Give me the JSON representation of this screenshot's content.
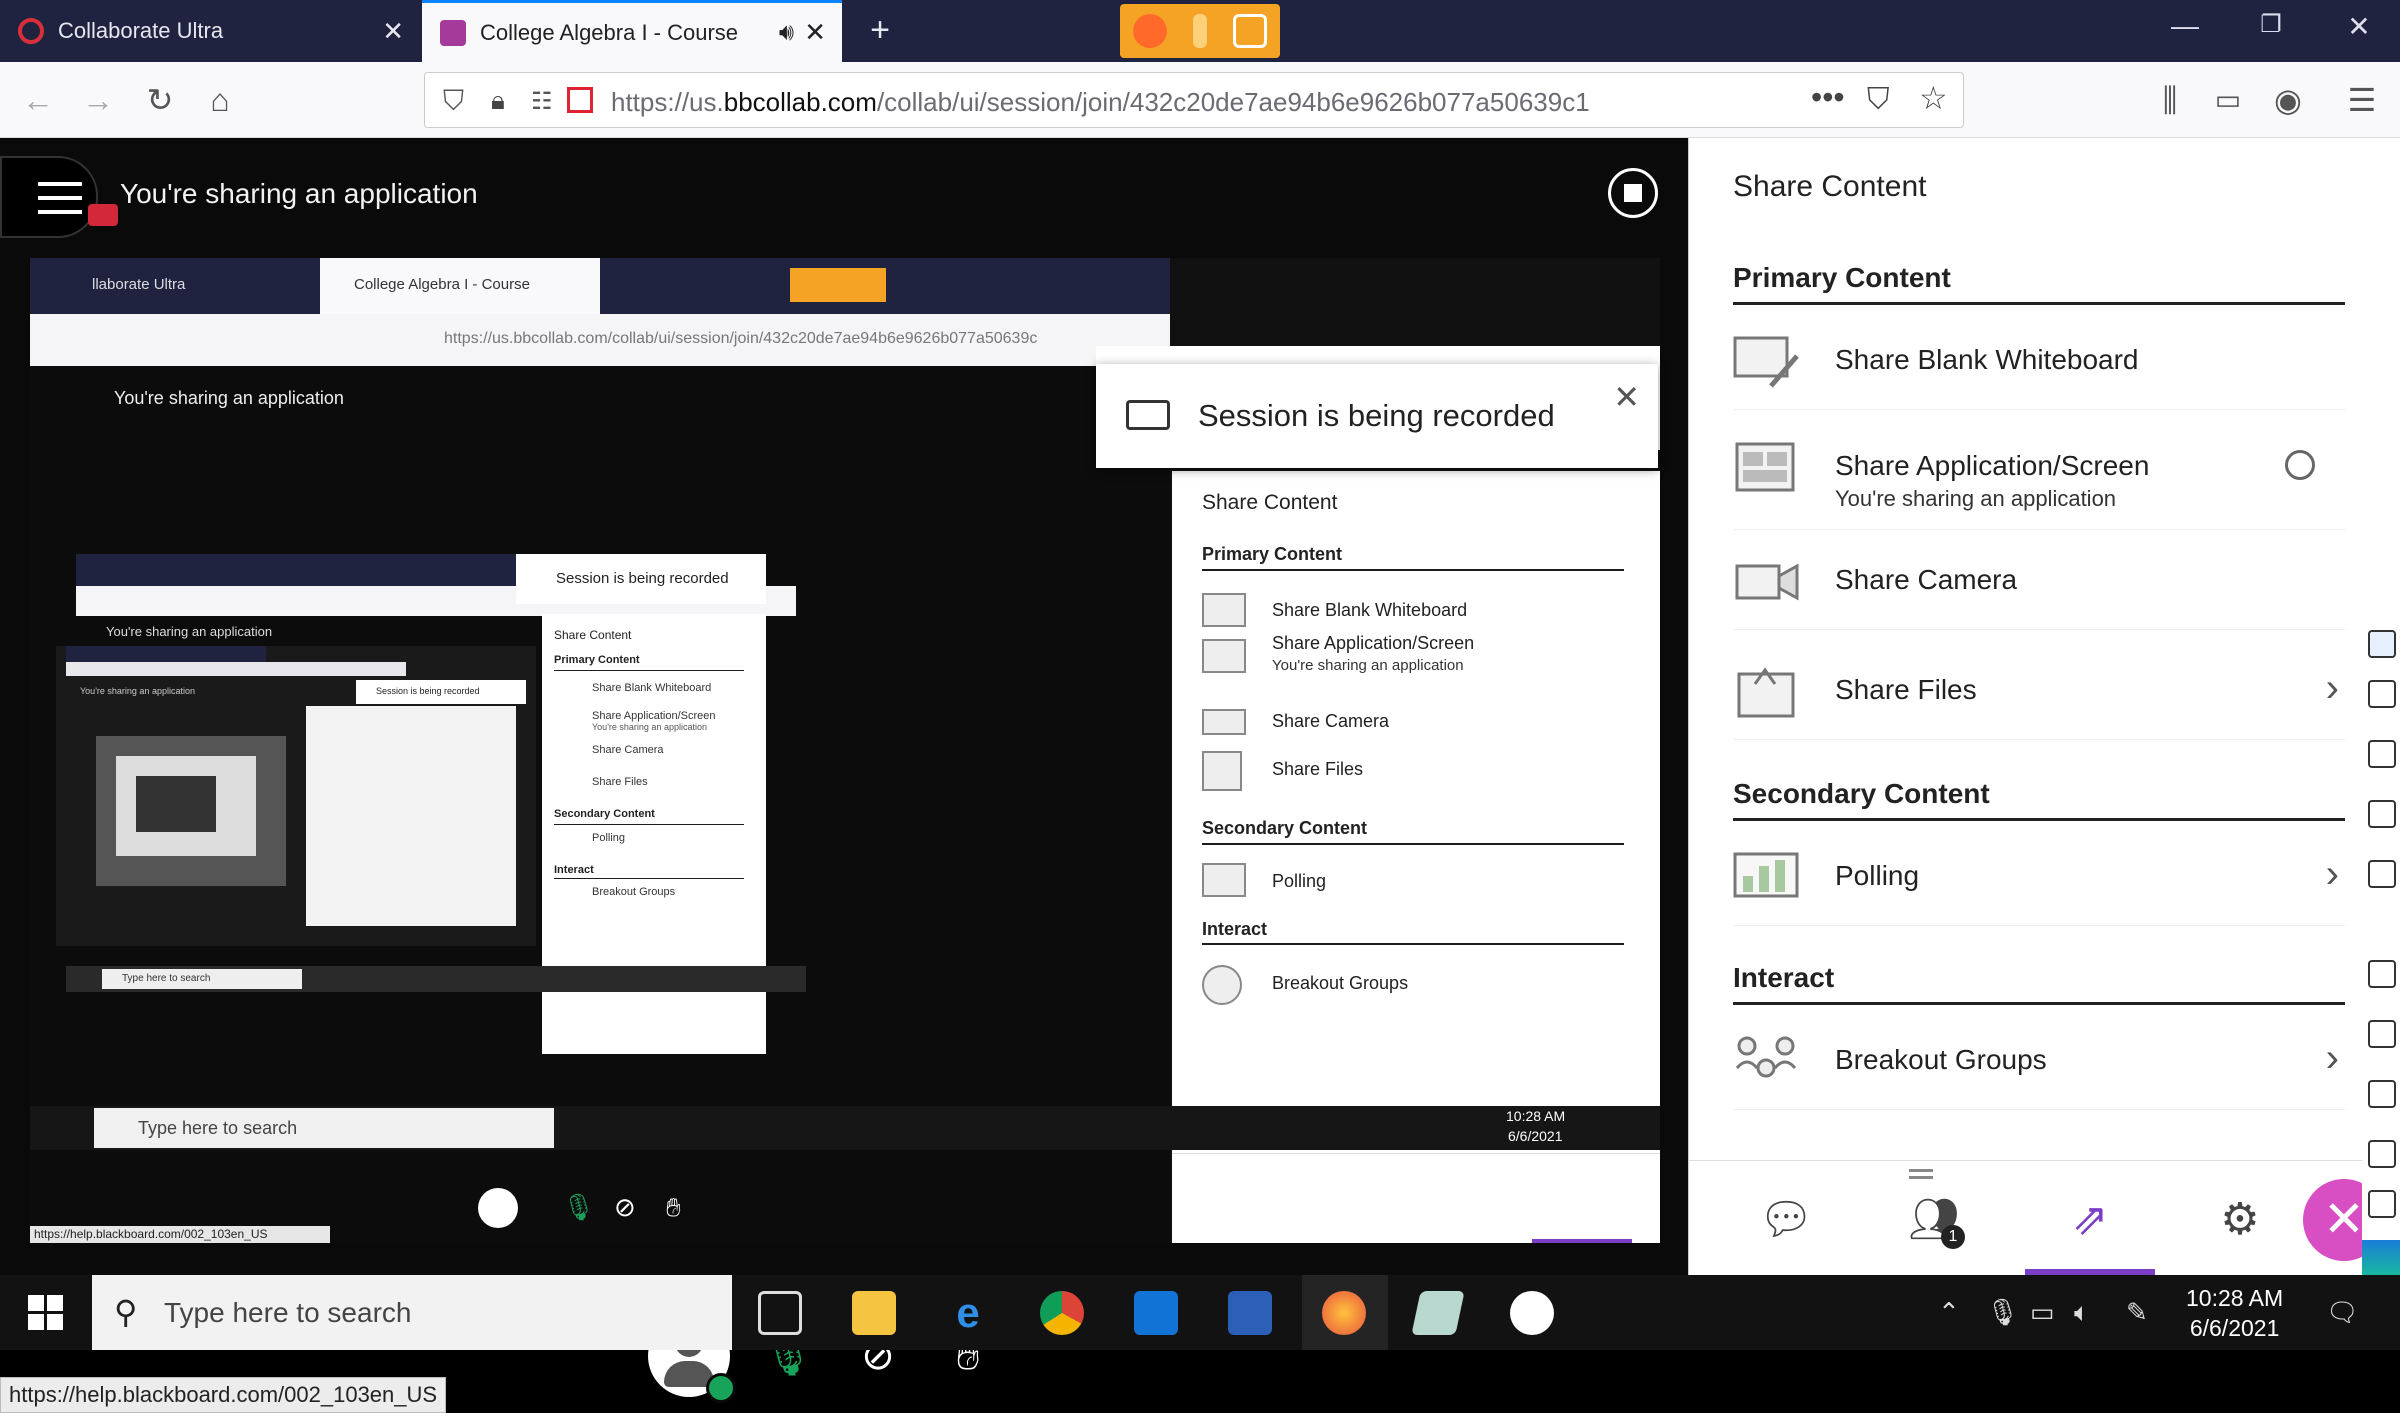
{
  "browser": {
    "tabs": [
      {
        "title": "Collaborate Ultra",
        "active": false
      },
      {
        "title": "College Algebra I - Course",
        "active": true
      }
    ],
    "url_prefix": "https://us.",
    "url_domain": "bbcollab.com",
    "url_path": "/collab/ui/session/join/432c20de7ae94b6e9626b077a50639c1"
  },
  "stage": {
    "sharing_label": "You're sharing an application",
    "recorded_toast": "Session is being recorded",
    "status_url": "https://help.blackboard.com/002_103en_US"
  },
  "nested": {
    "tab1": "llaborate Ultra",
    "tab2": "College Algebra I - Course",
    "url": "https://us.bbcollab.com/collab/ui/session/join/432c20de7ae94b6e9626b077a50639c",
    "sharing_label": "You're sharing an application",
    "recorded_toast": "Session is being recorded",
    "panel_title": "Share Content",
    "primary": "Primary Content",
    "whiteboard": "Share Blank Whiteboard",
    "app": "Share Application/Screen",
    "app_sub": "You're sharing an application",
    "camera": "Share Camera",
    "files": "Share Files",
    "secondary": "Secondary Content",
    "polling": "Polling",
    "interact": "Interact",
    "breakout": "Breakout Groups",
    "status_url": "https://help.blackboard.com/002_103en_US",
    "search": "Type here to search",
    "time": "10:28 AM",
    "date": "6/6/2021",
    "level2_sharing": "You're sharing an application",
    "level2_toast": "Session is being recorded",
    "level2_panel": "Share Content",
    "level2_primary": "Primary Content",
    "level2_whiteboard": "Share Blank Whiteboard",
    "level2_app": "Share Application/Screen",
    "level2_app_sub": "You're sharing an application",
    "level2_camera": "Share Camera",
    "level2_files": "Share Files",
    "level2_secondary": "Secondary Content",
    "level2_polling": "Polling",
    "level2_interact": "Interact",
    "level2_breakout": "Breakout Groups",
    "level2_search": "Type here to search",
    "level3_sharing": "You're sharing an application",
    "level3_toast": "Session is being recorded"
  },
  "panel": {
    "title": "Share Content",
    "sections": {
      "primary": "Primary Content",
      "secondary": "Secondary Content",
      "interact": "Interact"
    },
    "items": {
      "whiteboard": "Share Blank Whiteboard",
      "application": "Share Application/Screen",
      "application_sub": "You're sharing an application",
      "camera": "Share Camera",
      "files": "Share Files",
      "polling": "Polling",
      "breakout": "Breakout Groups"
    },
    "attendee_count": "1",
    "accent": "#7b3fc7"
  },
  "taskbar": {
    "search_placeholder": "Type here to search",
    "time": "10:28 AM",
    "date": "6/6/2021"
  }
}
